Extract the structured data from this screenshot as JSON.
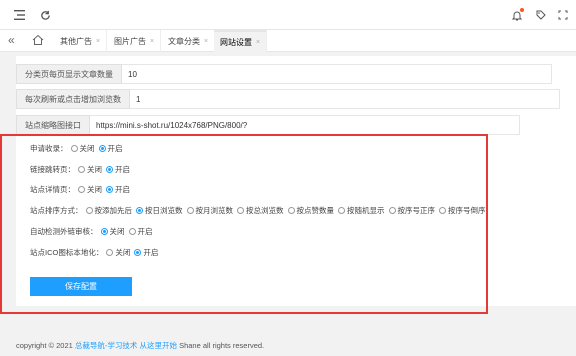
{
  "tabs": [
    {
      "label": "其他广告",
      "active": false
    },
    {
      "label": "图片广告",
      "active": false
    },
    {
      "label": "文章分类",
      "active": false
    },
    {
      "label": "网站设置",
      "active": true
    }
  ],
  "tab_close": "×",
  "fields": [
    {
      "label": "分类页每页显示文章数量",
      "value": "10"
    },
    {
      "label": "每次刷新或点击增加浏览数",
      "value": "1"
    },
    {
      "label": "站点缩略图接口",
      "value": "https://mini.s-shot.ru/1024x768/PNG/800/?"
    }
  ],
  "options": {
    "apply_collect": {
      "label": "申请收录：",
      "choices": [
        "关闭",
        "开启"
      ],
      "selected": 1
    },
    "link_redirect": {
      "label": "链接跳转页：",
      "choices": [
        "关闭",
        "开启"
      ],
      "selected": 1
    },
    "site_detail": {
      "label": "站点详情页：",
      "choices": [
        "关闭",
        "开启"
      ],
      "selected": 1
    },
    "site_sort": {
      "label": "站点排序方式：",
      "choices": [
        "按添加先后",
        "按日浏览数",
        "按月浏览数",
        "按总浏览数",
        "按点赞数量",
        "按随机显示",
        "按序号正序",
        "按序号倒序"
      ],
      "selected": 1
    },
    "auto_check": {
      "label": "自动检测外链审核：",
      "choices": [
        "关闭",
        "开启"
      ],
      "selected": 0
    },
    "ico_local": {
      "label": "站点ICO图标本地化：",
      "choices": [
        "关闭",
        "开启"
      ],
      "selected": 1
    }
  },
  "save_label": "保存配置",
  "footer": {
    "prefix": "copyright © 2021 ",
    "link": "总裁导航-学习技术 从这里开始",
    "suffix": " Shane all rights reserved."
  }
}
